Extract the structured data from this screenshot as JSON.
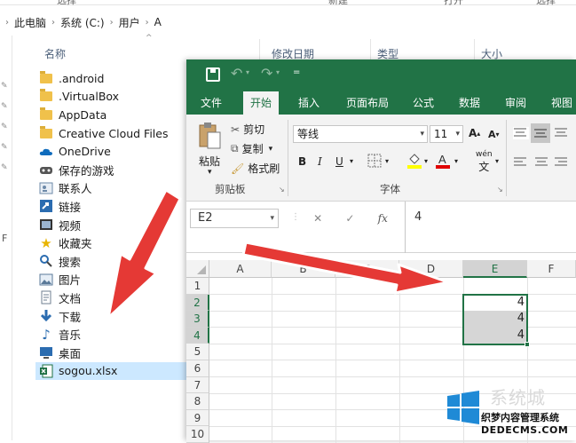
{
  "explorer": {
    "ribbon_strip": [
      "选择",
      "新建",
      "打开",
      "选择"
    ],
    "breadcrumb": [
      "此电脑",
      "系统 (C:)",
      "用户",
      "A"
    ],
    "columns": {
      "name": "名称",
      "modified": "修改日期",
      "type": "类型",
      "size": "大小"
    },
    "items": [
      {
        "label": ".android",
        "icon": "folder-icon"
      },
      {
        "label": ".VirtualBox",
        "icon": "folder-icon"
      },
      {
        "label": "AppData",
        "icon": "folder-icon"
      },
      {
        "label": "Creative Cloud Files",
        "icon": "folder-icon"
      },
      {
        "label": "OneDrive",
        "icon": "onedrive-icon"
      },
      {
        "label": "保存的游戏",
        "icon": "saved-games-icon"
      },
      {
        "label": "联系人",
        "icon": "contacts-icon"
      },
      {
        "label": "链接",
        "icon": "links-icon"
      },
      {
        "label": "视频",
        "icon": "videos-icon"
      },
      {
        "label": "收藏夹",
        "icon": "favorites-icon"
      },
      {
        "label": "搜索",
        "icon": "searches-icon"
      },
      {
        "label": "图片",
        "icon": "pictures-icon"
      },
      {
        "label": "文档",
        "icon": "documents-icon"
      },
      {
        "label": "下载",
        "icon": "downloads-icon"
      },
      {
        "label": "音乐",
        "icon": "music-icon"
      },
      {
        "label": "桌面",
        "icon": "desktop-icon"
      },
      {
        "label": "sogou.xlsx",
        "icon": "excel-file-icon",
        "selected": true
      }
    ],
    "left_pane_text": "F"
  },
  "excel": {
    "title": {
      "undo": "↶",
      "redo": "↷"
    },
    "tabs": [
      "文件",
      "开始",
      "插入",
      "页面布局",
      "公式",
      "数据",
      "审阅",
      "视图"
    ],
    "active_tab": "开始",
    "clipboard": {
      "paste": "粘贴",
      "cut": "剪切",
      "copy": "复制",
      "format_painter": "格式刷",
      "group": "剪贴板"
    },
    "font": {
      "name": "等线",
      "size": "11",
      "bold": "B",
      "italic": "I",
      "underline": "U",
      "phonetic": "wén",
      "group": "字体"
    },
    "name_box": "E2",
    "formula_value": "4",
    "columns": [
      "A",
      "B",
      "C",
      "D",
      "E",
      "F"
    ],
    "selected_column": "E",
    "rows": [
      "1",
      "2",
      "3",
      "4",
      "5",
      "6",
      "7",
      "8",
      "9",
      "10"
    ],
    "selected_rows": [
      "2",
      "3",
      "4"
    ],
    "cells": {
      "E2": "4",
      "E3": "4",
      "E4": "4"
    }
  },
  "watermark": {
    "site_name": "系统城",
    "caption": "织梦内容管理系统",
    "domain": "DEDECMS.COM"
  },
  "colors": {
    "excel_green": "#217346",
    "arrow_red": "#e53935",
    "selection_gray": "#d6d6d6"
  }
}
